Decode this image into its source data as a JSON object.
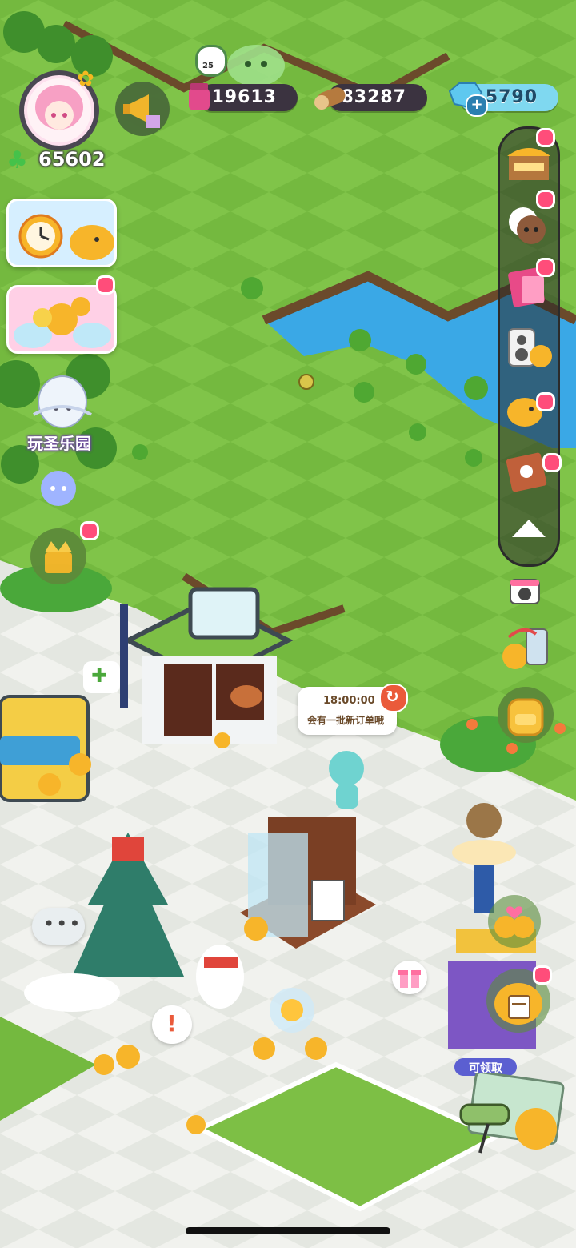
{
  "hud": {
    "level_badge": "25",
    "player_points": "65602",
    "currency_pink": "19613",
    "currency_wood": "83287",
    "currency_gems": "5790"
  },
  "left_panel": {
    "park_label": "玩圣乐园"
  },
  "order_bubble": {
    "timer": "18:00:00",
    "message": "会有一批新订单哦"
  },
  "claim_label": "可领取",
  "colors": {
    "grass": "#6fb43c",
    "water": "#3aa8e6",
    "path": "#e9ebe6",
    "notification": "#ff4d7a",
    "pill_bg": "#3b3340",
    "gem_pill": "#7fd8f0"
  },
  "icons": [
    "avatar-icon",
    "clover-icon",
    "megaphone-icon",
    "jam-jar-icon",
    "log-icon",
    "gem-icon",
    "plus-icon",
    "shop-stall-icon",
    "animal-heads-icon",
    "book-icon",
    "speaker-icon",
    "chick-icon",
    "recipe-book-icon",
    "arrow-up-icon",
    "camera-icon",
    "phone-swap-icon",
    "backpack-icon",
    "chat-icon",
    "gift-icon",
    "refresh-icon",
    "exclamation-icon"
  ]
}
